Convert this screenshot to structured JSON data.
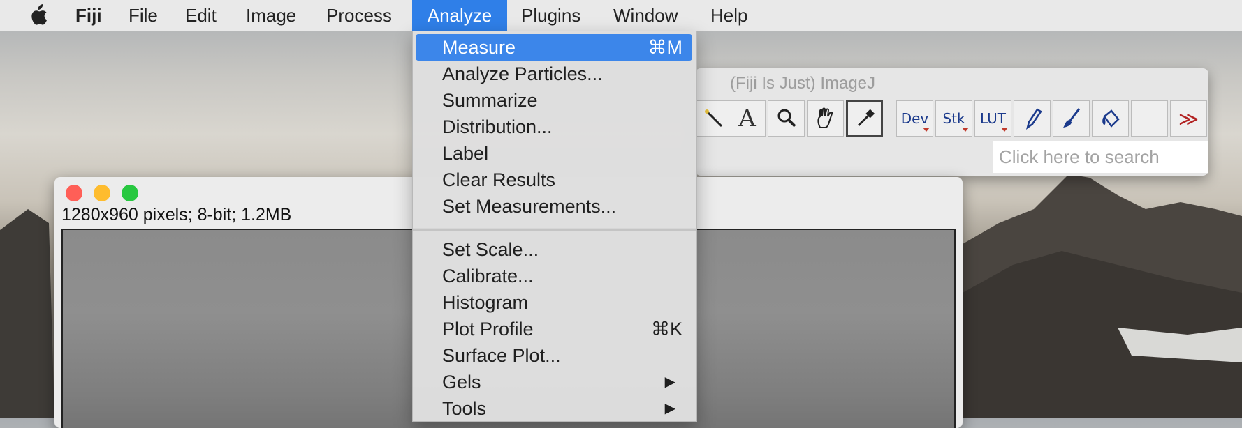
{
  "menubar": {
    "apple_icon": "apple-logo",
    "items": [
      "Fiji",
      "File",
      "Edit",
      "Image",
      "Process",
      "Analyze",
      "Plugins",
      "Window",
      "Help"
    ],
    "active": "Analyze"
  },
  "analyze_menu": {
    "group1": [
      {
        "label": "Measure",
        "shortcut": "⌘M"
      },
      {
        "label": "Analyze Particles...",
        "shortcut": ""
      },
      {
        "label": "Summarize",
        "shortcut": ""
      },
      {
        "label": "Distribution...",
        "shortcut": ""
      },
      {
        "label": "Label",
        "shortcut": ""
      },
      {
        "label": "Clear Results",
        "shortcut": ""
      },
      {
        "label": "Set Measurements...",
        "shortcut": ""
      }
    ],
    "group2": [
      {
        "label": "Set Scale...",
        "shortcut": ""
      },
      {
        "label": "Calibrate...",
        "shortcut": ""
      },
      {
        "label": "Histogram",
        "shortcut": ""
      },
      {
        "label": "Plot Profile",
        "shortcut": "⌘K"
      },
      {
        "label": "Surface Plot...",
        "shortcut": ""
      },
      {
        "label": "Gels",
        "submenu": true
      },
      {
        "label": "Tools",
        "submenu": true
      }
    ],
    "submenu_arrow": "▶",
    "highlighted": "Measure"
  },
  "imagej_window": {
    "title": "(Fiji Is Just) ImageJ",
    "tools": [
      {
        "name": "wand-tool-icon",
        "text": ""
      },
      {
        "name": "text-tool-icon",
        "text": "A"
      },
      {
        "name": "magnifier-tool-icon",
        "text": ""
      },
      {
        "name": "hand-tool-icon",
        "text": ""
      },
      {
        "name": "color-picker-tool-icon",
        "text": ""
      },
      {
        "name": "dev-menu-button",
        "text": "Dev"
      },
      {
        "name": "stk-menu-button",
        "text": "Stk"
      },
      {
        "name": "lut-menu-button",
        "text": "LUT"
      },
      {
        "name": "pencil-tool-icon",
        "text": ""
      },
      {
        "name": "brush-tool-icon",
        "text": ""
      },
      {
        "name": "flood-fill-tool-icon",
        "text": ""
      },
      {
        "name": "empty-tool-slot",
        "text": ""
      },
      {
        "name": "more-tools-icon",
        "text": "≫"
      }
    ],
    "search_placeholder": "Click here to search"
  },
  "image_window": {
    "info": "1280x960 pixels; 8-bit; 1.2MB",
    "traffic_lights": {
      "close": "#ff5f57",
      "minimize": "#febc2e",
      "zoom": "#28c840"
    }
  },
  "colors": {
    "accent": "#3c86ea",
    "menubar_bg": "#ebebeb"
  }
}
